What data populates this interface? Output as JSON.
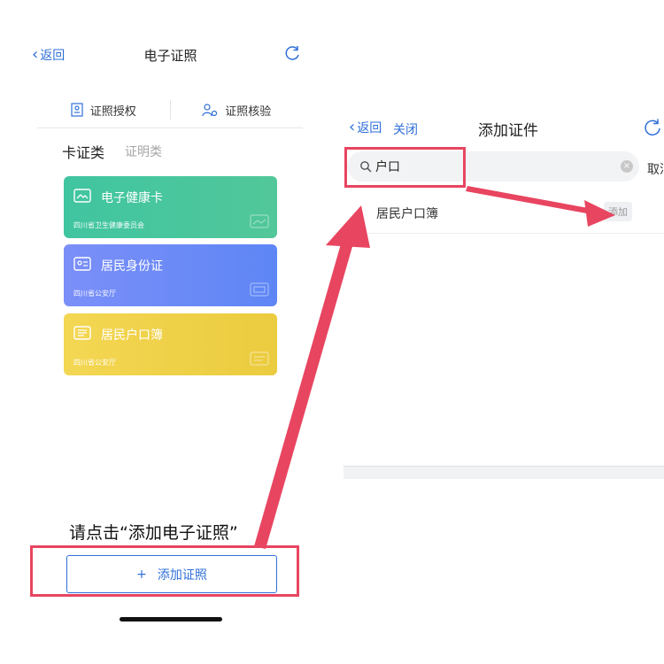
{
  "left_screen": {
    "nav": {
      "back_label": "返回",
      "title": "电子证照"
    },
    "tools": [
      {
        "label": "证照授权",
        "icon": "id-card-icon"
      },
      {
        "label": "证照核验",
        "icon": "user-verify-icon"
      }
    ],
    "category_tabs": [
      {
        "label": "卡证类",
        "active": true
      },
      {
        "label": "证明类",
        "active": false
      }
    ],
    "cards": [
      {
        "name": "电子健康卡",
        "issuer": "四川省卫生健康委员会",
        "color": "#45c49f",
        "icon": "health-card-icon"
      },
      {
        "name": "居民身份证",
        "issuer": "四川省公安厅",
        "color": "#6e8bf7",
        "icon": "id-card-icon"
      },
      {
        "name": "居民户口簿",
        "issuer": "四川省公安厅",
        "color": "#efcc2c",
        "icon": "household-book-icon"
      }
    ],
    "instruction": "请点击“添加电子证照”",
    "add_button": {
      "plus": "+",
      "label": "添加证照"
    }
  },
  "right_screen": {
    "nav": {
      "back_label": "返回",
      "close_label": "关闭",
      "title": "添加证件"
    },
    "search": {
      "value": "户口",
      "cancel_label": "取消"
    },
    "results": [
      {
        "name": "居民户口簿",
        "action": "添加"
      }
    ]
  },
  "colors": {
    "accent": "#2f6fd8",
    "annotation_red": "#e84560"
  }
}
